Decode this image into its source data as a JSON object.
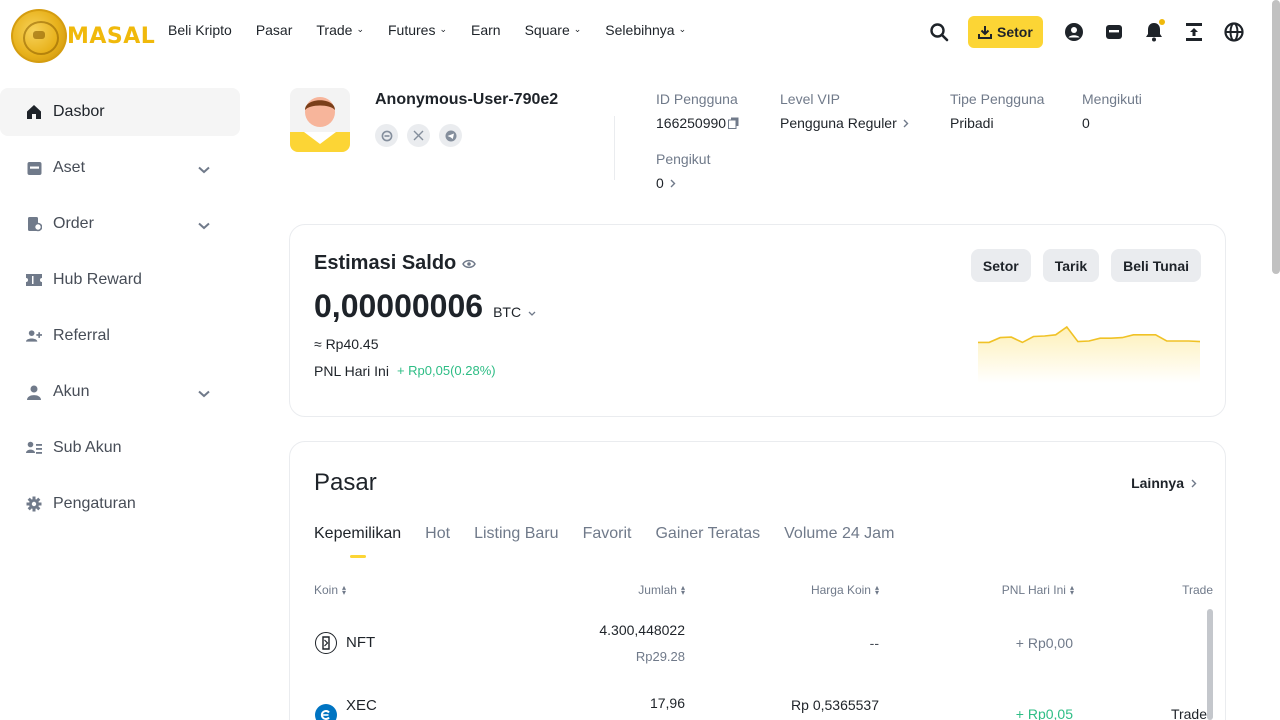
{
  "brand": {
    "name": "MASAL"
  },
  "nav": [
    {
      "label": "Beli Kripto",
      "dropdown": false
    },
    {
      "label": "Pasar",
      "dropdown": false
    },
    {
      "label": "Trade",
      "dropdown": true
    },
    {
      "label": "Futures",
      "dropdown": true
    },
    {
      "label": "Earn",
      "dropdown": false
    },
    {
      "label": "Square",
      "dropdown": true
    },
    {
      "label": "Selebihnya",
      "dropdown": true
    }
  ],
  "header": {
    "deposit_label": "Setor",
    "accent": "#fcd535"
  },
  "sidebar": {
    "items": [
      {
        "label": "Dasbor",
        "icon": "home-icon",
        "active": true,
        "expandable": false
      },
      {
        "label": "Aset",
        "icon": "wallet-icon",
        "active": false,
        "expandable": true
      },
      {
        "label": "Order",
        "icon": "order-icon",
        "active": false,
        "expandable": true
      },
      {
        "label": "Hub Reward",
        "icon": "ticket-icon",
        "active": false,
        "expandable": false
      },
      {
        "label": "Referral",
        "icon": "user-plus-icon",
        "active": false,
        "expandable": false
      },
      {
        "label": "Akun",
        "icon": "user-icon",
        "active": false,
        "expandable": true
      },
      {
        "label": "Sub Akun",
        "icon": "sub-account-icon",
        "active": false,
        "expandable": false
      },
      {
        "label": "Pengaturan",
        "icon": "gear-icon",
        "active": false,
        "expandable": false
      }
    ]
  },
  "profile": {
    "username": "Anonymous-User-790e2",
    "user_id_label": "ID Pengguna",
    "user_id": "166250990",
    "vip_label": "Level VIP",
    "vip_value": "Pengguna Reguler",
    "type_label": "Tipe Pengguna",
    "type_value": "Pribadi",
    "following_label": "Mengikuti",
    "following_value": "0",
    "followers_label": "Pengikut",
    "followers_value": "0"
  },
  "balance": {
    "title": "Estimasi Saldo",
    "amount": "0,00000006",
    "unit": "BTC",
    "fiat": "≈ Rp40.45",
    "pnl_label": "PNL Hari Ini",
    "pnl_value": "+ Rp0,05(0.28%)",
    "buttons": [
      "Setor",
      "Tarik",
      "Beli Tunai"
    ],
    "sparkline": [
      0.45,
      0.45,
      0.62,
      0.64,
      0.45,
      0.66,
      0.68,
      0.72,
      1.0,
      0.48,
      0.5,
      0.6,
      0.6,
      0.62,
      0.72,
      0.72,
      0.72,
      0.5,
      0.5,
      0.5,
      0.48
    ],
    "positive_color": "#2ebd85"
  },
  "market": {
    "title": "Pasar",
    "more_label": "Lainnya",
    "tabs": [
      "Kepemilikan",
      "Hot",
      "Listing Baru",
      "Favorit",
      "Gainer Teratas",
      "Volume 24 Jam"
    ],
    "columns": {
      "coin": "Koin",
      "amount": "Jumlah",
      "price": "Harga Koin",
      "pnl": "PNL Hari Ini",
      "trade": "Trade"
    },
    "rows": [
      {
        "coin": "NFT",
        "amount": "4.300,448022",
        "amount_fiat": "Rp29.28",
        "price": "--",
        "pnl": "+ Rp0,00",
        "trade": ""
      },
      {
        "coin": "XEC",
        "amount": "17,96",
        "amount_fiat": "",
        "price": "Rp 0,5365537",
        "pnl": "+ Rp0,05",
        "trade": "Trade"
      }
    ]
  }
}
